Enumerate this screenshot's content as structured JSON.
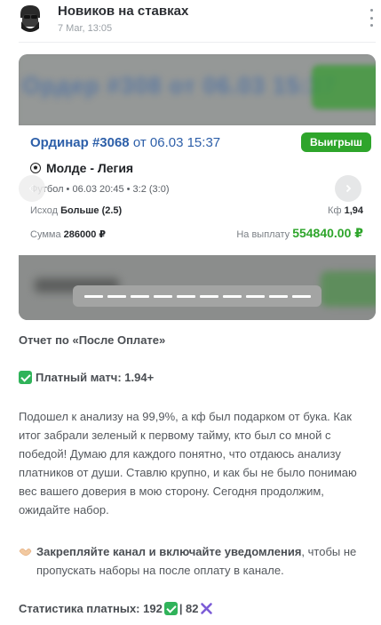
{
  "header": {
    "channel_name": "Новиков на ставках",
    "post_date": "7 Mar, 13:05"
  },
  "bet": {
    "type_label": "Ординар",
    "number": "#3068",
    "from_word": "от",
    "date": "06.03 15:37",
    "status": "Выигрыш",
    "match": "Молде - Легия",
    "meta": "Футбол  •  06.03 20:45  •  3:2 (3:0)",
    "outcome_label": "Исход",
    "outcome_value": "Больше (2.5)",
    "coef_label": "Кф",
    "coef_value": "1,94",
    "sum_label": "Сумма",
    "sum_value": "286000 ₽",
    "payout_label": "На выплату",
    "payout_value": "554840.00 ₽"
  },
  "gallery": {
    "slide_count": 10
  },
  "post": {
    "report_title": "Отчет по «После Оплате»",
    "paid_match": "Платный матч: 1.94+",
    "paragraph": "Подошел к анализу на 99,9%, а кф был подарком от бука. Как итог забрали зеленый к первому тайму, кто был со мной с победой! Думаю для каждого понятно, что отдаюсь анализу платников от души. Ставлю крупно, и как бы не было понимаю вес вашего доверия в мою сторону. Сегодня продолжим, ожидайте набор.",
    "promo_bold": "Закрепляйте канал и включайте уведомления",
    "promo_rest": ", чтобы не пропускать наборы на после оплату в канале.",
    "stats_label": "Статистика платных: 192",
    "stats_separator": "| 82"
  },
  "colors": {
    "accent_blue": "#2d5fa9",
    "win_green": "#2ea52b",
    "check_green": "#30b35a",
    "cross_purple": "#7b5cd6"
  }
}
